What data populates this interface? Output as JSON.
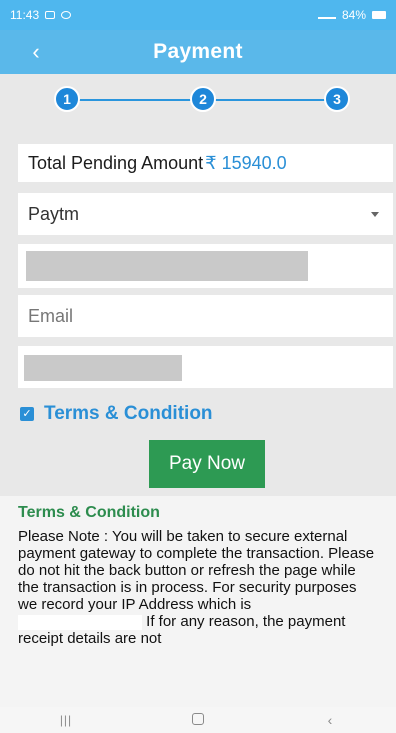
{
  "status_bar": {
    "time": "11:43",
    "battery": "84%"
  },
  "header": {
    "title": "Payment"
  },
  "stepper": {
    "steps": [
      "1",
      "2",
      "3"
    ]
  },
  "amount": {
    "label": "Total Pending Amount",
    "value": "₹ 15940.0"
  },
  "payment_method": {
    "selected": "Paytm"
  },
  "email": {
    "placeholder": "Email"
  },
  "terms_toggle": {
    "label": "Terms & Condition",
    "checked": true
  },
  "pay_button": {
    "label": "Pay Now"
  },
  "terms": {
    "heading": "Terms & Condition",
    "text_part1": "Please Note : You will be taken to secure external payment gateway to complete the transaction. Please do not hit the back button or refresh the page while the transaction is in process. For security purposes we record your IP Address which is",
    "text_part2": "If for any reason, the payment receipt details are not"
  },
  "colors": {
    "header": "#5ab8ea",
    "accent_blue": "#2a8fd6",
    "pay_green": "#2d9a53",
    "form_bg": "#e8e8e8"
  }
}
